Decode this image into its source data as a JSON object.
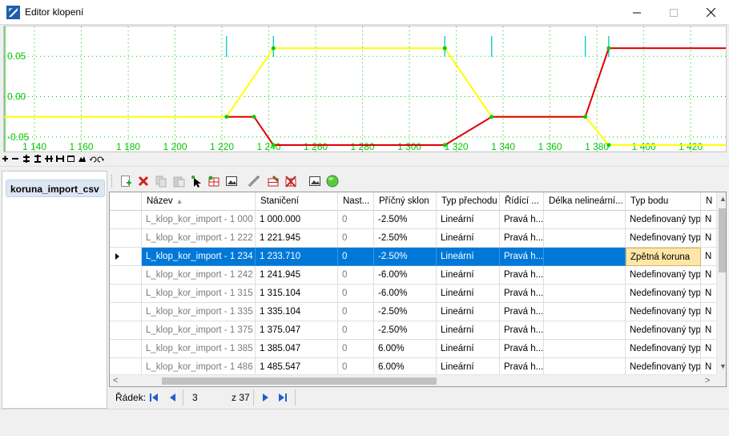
{
  "window": {
    "title": "Editor klopení"
  },
  "chart_data": {
    "type": "line",
    "x_ticks": [
      "1 140",
      "1 160",
      "1 180",
      "1 200",
      "1 220",
      "1 240",
      "1 260",
      "1 280",
      "1 300",
      "1 320",
      "1 340",
      "1 360",
      "1 380",
      "1 400",
      "1 420"
    ],
    "y_ticks": [
      "0.05",
      "0.00",
      "-0.05"
    ],
    "xlim": [
      1127,
      1435
    ],
    "ylim": [
      -0.068,
      0.087
    ],
    "grid": true,
    "series": [
      {
        "color": "#ffff00",
        "points": [
          [
            1127,
            -0.025
          ],
          [
            1221.945,
            -0.025
          ],
          [
            1241.945,
            0.06
          ],
          [
            1315.104,
            0.06
          ],
          [
            1335.104,
            -0.025
          ],
          [
            1375.047,
            -0.025
          ],
          [
            1385.047,
            -0.06
          ],
          [
            1435,
            -0.06
          ]
        ]
      },
      {
        "color": "#e00000",
        "points": [
          [
            1221.945,
            -0.025
          ],
          [
            1233.71,
            -0.025
          ],
          [
            1241.945,
            -0.06
          ],
          [
            1315.104,
            -0.06
          ],
          [
            1335.104,
            -0.025
          ],
          [
            1375.047,
            -0.025
          ],
          [
            1385.047,
            0.06
          ],
          [
            1435,
            0.06
          ]
        ]
      }
    ],
    "vertex_markers": [
      [
        1221.945,
        -0.025
      ],
      [
        1233.71,
        -0.025
      ],
      [
        1241.945,
        0.06
      ],
      [
        1241.945,
        -0.06
      ],
      [
        1315.104,
        0.06
      ],
      [
        1315.104,
        -0.06
      ],
      [
        1335.104,
        -0.025
      ],
      [
        1375.047,
        -0.025
      ],
      [
        1385.047,
        0.06
      ],
      [
        1385.047,
        -0.06
      ]
    ],
    "station_markers": [
      1221.945,
      1241.945,
      1315.104,
      1335.104,
      1375.047,
      1385.047
    ],
    "colors": {
      "axis_labels": "#00c800",
      "grid": "#00c800",
      "station_marker": "#00c8c8",
      "vertex": "#00d000"
    }
  },
  "left_panel": {
    "selected_profile": "koruna_import_csv"
  },
  "grid": {
    "columns": [
      "Název",
      "Staničení",
      "Nast...",
      "Příčný sklon",
      "Typ přechodu",
      "Řídící ...",
      "Délka nelineární...",
      "Typ bodu",
      "N"
    ],
    "sort_indicator": "▲",
    "rows": [
      [
        "L_klop_kor_import - 1 000",
        "1 000.000",
        "0",
        "-2.50%",
        "Lineární",
        "Pravá h...",
        "",
        "Nedefinovaný typ",
        "N"
      ],
      [
        "L_klop_kor_import - 1 222",
        "1 221.945",
        "0",
        "-2.50%",
        "Lineární",
        "Pravá h...",
        "",
        "Nedefinovaný typ",
        "N"
      ],
      [
        "L_klop_kor_import - 1 234",
        "1 233.710",
        "0",
        "-2.50%",
        "Lineární",
        "Pravá h...",
        "",
        "Zpětná koruna",
        "N"
      ],
      [
        "L_klop_kor_import - 1 242",
        "1 241.945",
        "0",
        "-6.00%",
        "Lineární",
        "Pravá h...",
        "",
        "Nedefinovaný typ",
        "N"
      ],
      [
        "L_klop_kor_import - 1 315",
        "1 315.104",
        "0",
        "-6.00%",
        "Lineární",
        "Pravá h...",
        "",
        "Nedefinovaný typ",
        "N"
      ],
      [
        "L_klop_kor_import - 1 335",
        "1 335.104",
        "0",
        "-2.50%",
        "Lineární",
        "Pravá h...",
        "",
        "Nedefinovaný typ",
        "N"
      ],
      [
        "L_klop_kor_import - 1 375",
        "1 375.047",
        "0",
        "-2.50%",
        "Lineární",
        "Pravá h...",
        "",
        "Nedefinovaný typ",
        "N"
      ],
      [
        "L_klop_kor_import - 1 385",
        "1 385.047",
        "0",
        "6.00%",
        "Lineární",
        "Pravá h...",
        "",
        "Nedefinovaný typ",
        "N"
      ],
      [
        "L_klop_kor_import - 1 486",
        "1 485.547",
        "0",
        "6.00%",
        "Lineární",
        "Pravá h...",
        "",
        "Nedefinovaný typ",
        "N"
      ]
    ],
    "selected_row": 2
  },
  "navigator": {
    "label": "Řádek:",
    "current": "3",
    "total": "z 37"
  }
}
